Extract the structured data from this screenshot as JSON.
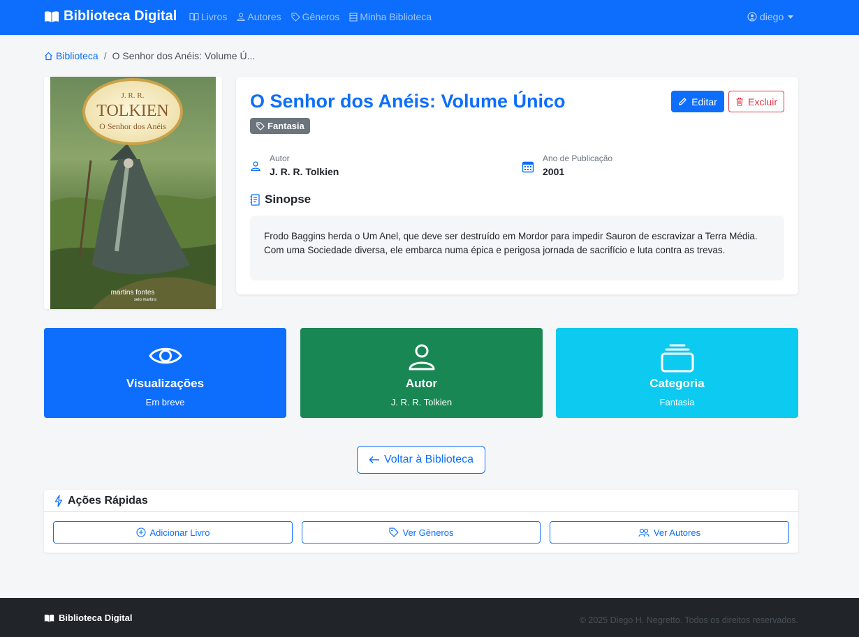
{
  "navbar": {
    "brand": "Biblioteca Digital",
    "links": [
      {
        "label": "Livros",
        "icon": "book-icon"
      },
      {
        "label": "Autores",
        "icon": "person-icon"
      },
      {
        "label": "Gêneros",
        "icon": "tag-icon"
      },
      {
        "label": "Minha Biblioteca",
        "icon": "bookshelf-icon"
      }
    ],
    "user": "diego"
  },
  "breadcrumb": {
    "home": "Biblioteca",
    "separator": "/",
    "current": "O Senhor dos Anéis: Volume Ú..."
  },
  "cover": {
    "author_text": "J. R. R.",
    "author_surname": "TOLKIEN",
    "title_text": "O Senhor dos Anéis",
    "publisher": "martins fontes",
    "imprint": "selo martins"
  },
  "book": {
    "title": "O Senhor dos Anéis: Volume Único",
    "genre": "Fantasia",
    "edit_label": "Editar",
    "delete_label": "Excluir",
    "author_label": "Autor",
    "author": "J. R. R. Tolkien",
    "year_label": "Ano de Publicação",
    "year": "2001",
    "synopsis_heading": "Sinopse",
    "synopsis": "Frodo Baggins herda o Um Anel, que deve ser destruído em Mordor para impedir Sauron de escravizar a Terra Média. Com uma Sociedade diversa, ele embarca numa épica e perigosa jornada de sacrifício e luta contra as trevas."
  },
  "stats": [
    {
      "title": "Visualizações",
      "subtitle": "Em breve",
      "icon": "eye-icon",
      "color": "#0d6efd"
    },
    {
      "title": "Autor",
      "subtitle": "J. R. R. Tolkien",
      "icon": "person-icon",
      "color": "#198754"
    },
    {
      "title": "Categoria",
      "subtitle": "Fantasia",
      "icon": "collection-icon",
      "color": "#0dcaf0"
    }
  ],
  "back_button": "Voltar à Biblioteca",
  "quick_actions": {
    "heading": "Ações Rápidas",
    "buttons": [
      {
        "label": "Adicionar Livro",
        "icon": "plus-circle-icon"
      },
      {
        "label": "Ver Gêneros",
        "icon": "tag-icon"
      },
      {
        "label": "Ver Autores",
        "icon": "people-icon"
      }
    ]
  },
  "footer": {
    "brand": "Biblioteca Digital",
    "copyright": "© 2025 Diego H. Negretto. Todos os direitos reservados."
  },
  "colors": {
    "primary": "#0d6efd",
    "success": "#198754",
    "info": "#0dcaf0",
    "danger": "#dc3545",
    "secondary": "#6c757d",
    "dark": "#212529"
  }
}
